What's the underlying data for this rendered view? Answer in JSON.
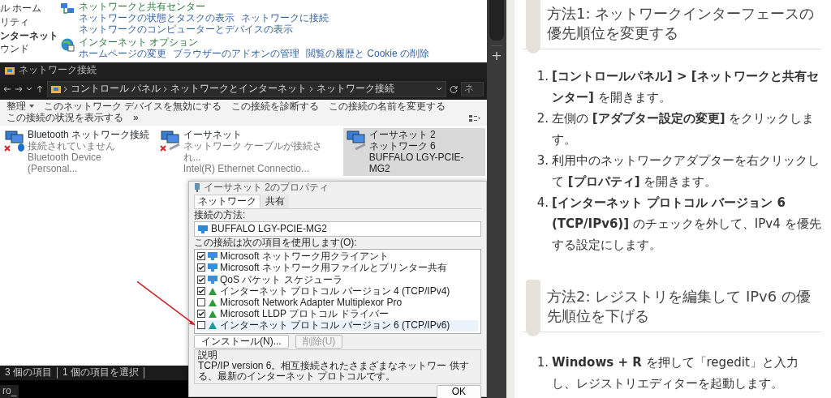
{
  "control_panel": {
    "sidebar_items": [
      {
        "label": "ル ホーム",
        "selected": false
      },
      {
        "label": "リティ",
        "selected": false
      },
      {
        "label": "ンターネット",
        "selected": true
      },
      {
        "label": "ウンド",
        "selected": false
      }
    ],
    "categories": [
      {
        "kind": "network",
        "title": "ネットワークと共有センター",
        "links": [
          "ネットワークの状態とタスクの表示",
          "ネットワークに接続",
          "ネットワークのコンピューターとデバイスの表示"
        ]
      },
      {
        "kind": "internet",
        "title": "インターネット オプション",
        "links": [
          "ホームページの変更",
          "ブラウザーのアドオンの管理",
          "閲覧の履歴と Cookie の削除"
        ]
      }
    ]
  },
  "explorer": {
    "title": "ネットワーク接続",
    "breadcrumb": [
      "コントロール パネル",
      "ネットワークとインターネット",
      "ネットワーク接続"
    ],
    "search_placeholder": "ネ",
    "toolbar": [
      {
        "label": "整理",
        "dropdown": true
      },
      {
        "label": "このネットワーク デバイスを無効にする",
        "dropdown": false
      },
      {
        "label": "この接続を診断する",
        "dropdown": false
      },
      {
        "label": "この接続の名前を変更する",
        "dropdown": false
      },
      {
        "label": "この接続の状況を表示する",
        "dropdown": false
      }
    ],
    "toolbar_more": "»",
    "adapters": [
      {
        "kind": "bluetooth",
        "name": "Bluetooth ネットワーク接続",
        "status": "接続されていません",
        "device": "Bluetooth Device (Personal...",
        "connected": false,
        "selected": false
      },
      {
        "kind": "ethernet",
        "name": "イーサネット",
        "status": "ネットワーク ケーブルが接続され...",
        "device": "Intel(R) Ethernet Connectio...",
        "connected": false,
        "selected": false
      },
      {
        "kind": "ethernet",
        "name": "イーサネット 2",
        "status": "ネットワーク 6",
        "device": "BUFFALO LGY-PCIE-MG2",
        "connected": true,
        "selected": true
      }
    ],
    "status_bar": [
      "3 個の項目",
      "1 個の項目を選択"
    ]
  },
  "dialog": {
    "title": "イーサネット 2のプロパティ",
    "tabs": [
      {
        "label": "ネットワーク",
        "selected": true
      },
      {
        "label": "共有",
        "selected": false
      }
    ],
    "connect_label": "接続の方法:",
    "adapter": "BUFFALO LGY-PCIE-MG2",
    "items_label": "この接続は次の項目を使用します(O):",
    "items": [
      {
        "kind": "client",
        "label": "Microsoft ネットワーク用クライアント",
        "checked": true,
        "selected": false
      },
      {
        "kind": "client",
        "label": "Microsoft ネットワーク用ファイルとプリンター共有",
        "checked": true,
        "selected": false
      },
      {
        "kind": "client",
        "label": "QoS パケット スケジューラ",
        "checked": true,
        "selected": false
      },
      {
        "kind": "protocol",
        "label": "インターネット プロトコル バージョン 4 (TCP/IPv4)",
        "checked": true,
        "selected": false
      },
      {
        "kind": "protocol",
        "label": "Microsoft Network Adapter Multiplexor Pro",
        "checked": false,
        "selected": false
      },
      {
        "kind": "protocol",
        "label": "Microsoft LLDP プロトコル ドライバー",
        "checked": true,
        "selected": false
      },
      {
        "kind": "protocol",
        "label": "インターネット プロトコル バージョン 6 (TCP/IPv6)",
        "checked": false,
        "selected": true
      }
    ],
    "buttons": [
      {
        "label": "インストール(N)...",
        "disabled": false
      },
      {
        "label": "削除(U)",
        "disabled": true
      }
    ],
    "description_label": "説明",
    "description": "TCP/IP version 6。相互接続されたさまざまなネットワー 供する、最新のインターネット プロトコルです。",
    "ok": "OK"
  },
  "taskbar_text": "ro_",
  "tab_strip": {
    "new_tab": "+"
  },
  "article": {
    "sections": [
      {
        "heading": "方法1: ネットワークインターフェースの優先順位を変更する",
        "steps": [
          {
            "number": "1.",
            "text": "**[コントロールパネル] > [ネットワークと共有センター]** を開きます。"
          },
          {
            "number": "2.",
            "text": "左側の **[アダプター設定の変更]** をクリックします。"
          },
          {
            "number": "3.",
            "text": "利用中のネットワークアダプターを右クリックして **[プロパティ]** を開きます。"
          },
          {
            "number": "4.",
            "text": "**[インターネット プロトコル バージョン 6 (TCP/IPv6)]** のチェックを外して、IPv4 を優先する設定にします。"
          }
        ]
      },
      {
        "heading": "方法2: レジストリを編集して IPv6 の優先順位を下げる",
        "steps": [
          {
            "number": "1.",
            "text": "**Windows + R** を押して「regedit」と入力し、レジストリエディターを起動します。"
          }
        ]
      }
    ]
  }
}
